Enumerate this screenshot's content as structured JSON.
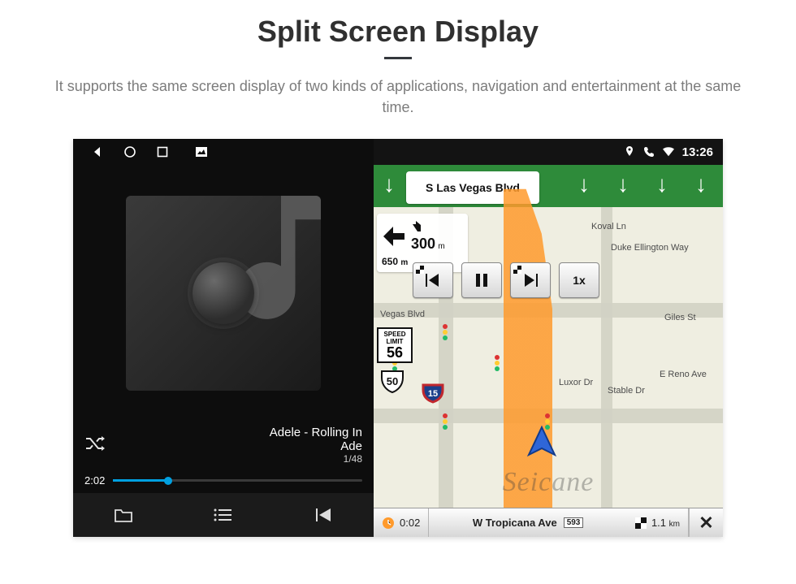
{
  "page": {
    "title": "Split Screen Display",
    "subtitle": "It supports the same screen display of two kinds of applications, navigation and entertainment at the same time."
  },
  "status": {
    "time": "13:26"
  },
  "player": {
    "track_title": "Adele - Rolling In",
    "artist": "Ade",
    "index": "1/48",
    "elapsed": "2:02"
  },
  "nav": {
    "lane_sign": "S Las Vegas Blvd",
    "turn": {
      "next_dist_value": "300",
      "next_dist_unit": "m",
      "cur_dist_value": "650",
      "cur_dist_unit": "m"
    },
    "speed_limit_label": "SPEED LIMIT",
    "speed_limit": "56",
    "us_route": "50",
    "interstate": "15",
    "playback_speed": "1x",
    "streets": {
      "vegas_blvd": "Vegas Blvd",
      "koval": "Koval Ln",
      "ellington": "Duke Ellington Way",
      "reno": "E Reno Ave",
      "luxor": "Luxor Dr",
      "giles": "Giles St",
      "stable": "Stable Dr"
    },
    "bottom": {
      "eta": "0:02",
      "dist_value": "1.1",
      "dist_unit": "km",
      "road": "W Tropicana Ave",
      "exit": "593"
    }
  },
  "watermark": "Seicane"
}
